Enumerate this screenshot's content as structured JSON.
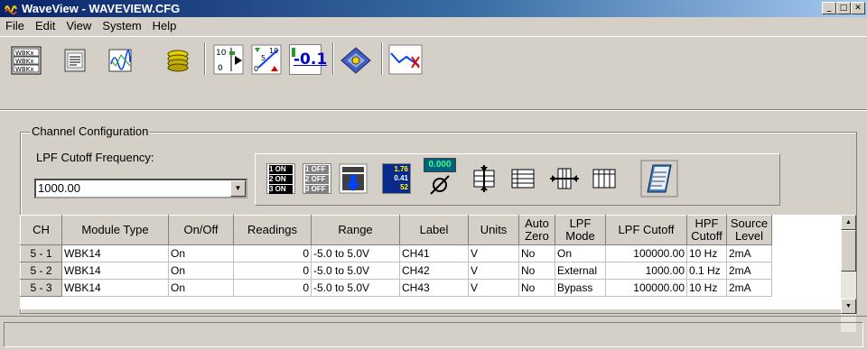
{
  "window": {
    "title": "WaveView - WAVEVIEW.CFG",
    "min": "_",
    "max": "□",
    "close": "✕"
  },
  "menu": [
    "File",
    "Edit",
    "View",
    "System",
    "Help"
  ],
  "toolbar": {
    "icons": [
      "select-wbk-icon",
      "notepad-icon",
      "scope-icon",
      "disk-stack-icon",
      "acquire-range-icon",
      "scale-needle-icon",
      "digital-value-icon",
      "target-diamond-icon",
      "waveform-display-icon"
    ],
    "digital_text": "-0.1",
    "range_top": "10",
    "range_bottom": "0",
    "scale_top": "10",
    "scale_mid": "5",
    "scale_low": "0"
  },
  "config": {
    "group_title": "Channel Configuration",
    "lpf_label": "LPF Cutoff Frequency:",
    "lpf_value": "1000.00",
    "cfg_icons": [
      "all-on-icon",
      "all-off-icon",
      "channel-update-icon",
      "readings-icon",
      "meter-zero-icon",
      "compress-rows-icon",
      "table-rows-icon",
      "expand-cols-icon",
      "table-cols-icon",
      "notes-icon"
    ],
    "all_on": [
      "1 ON",
      "2 ON",
      "3 ON"
    ],
    "all_off": [
      "1 OFF",
      "2 OFF",
      "3 OFF"
    ],
    "readings": [
      "1.76",
      "0.41",
      "52"
    ],
    "meter_value": "0.000"
  },
  "table": {
    "headers": [
      "CH",
      "Module Type",
      "On/Off",
      "Readings",
      "Range",
      "Label",
      "Units",
      "Auto Zero",
      "LPF Mode",
      "LPF Cutoff",
      "HPF Cutoff",
      "Source Level"
    ],
    "rows": [
      [
        "5 - 1",
        "WBK14",
        "On",
        "0",
        "-5.0 to 5.0V",
        "CH41",
        "V",
        "No",
        "On",
        "100000.00",
        "10 Hz",
        "2mA"
      ],
      [
        "5 - 2",
        "WBK14",
        "On",
        "0",
        "-5.0 to 5.0V",
        "CH42",
        "V",
        "No",
        "External",
        "1000.00",
        "0.1 Hz",
        "2mA"
      ],
      [
        "5 - 3",
        "WBK14",
        "On",
        "0",
        "-5.0 to 5.0V",
        "CH43",
        "V",
        "No",
        "Bypass",
        "100000.00",
        "10 Hz",
        "2mA"
      ]
    ]
  },
  "colors": {
    "title_bar": "#0a246a",
    "face": "#d4d0c8",
    "accent_blue": "#0000cc"
  }
}
